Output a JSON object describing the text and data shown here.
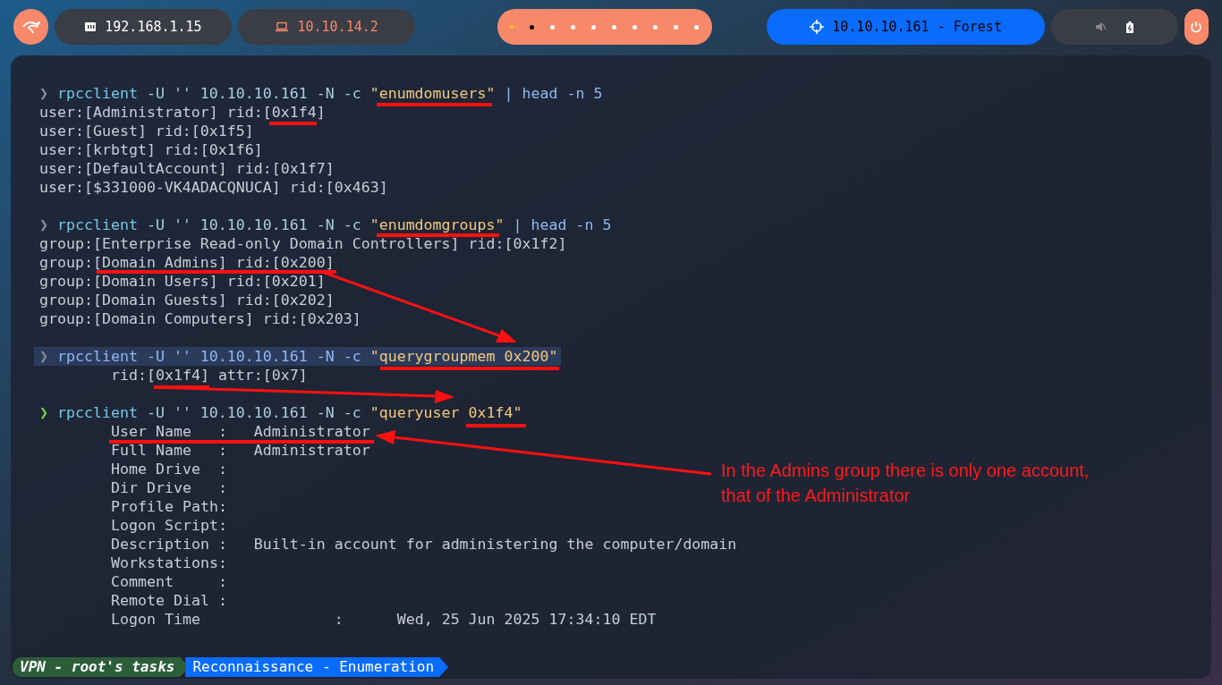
{
  "top_bar": {
    "ip_local": "192.168.1.15",
    "ip_vpn": "10.10.14.2",
    "workspaces": [
      {
        "kind": "occupied",
        "selected": false
      },
      {
        "kind": "plain",
        "selected": true
      },
      {
        "kind": "plain",
        "selected": false
      },
      {
        "kind": "plain",
        "selected": false
      },
      {
        "kind": "plain",
        "selected": false
      },
      {
        "kind": "plain",
        "selected": false
      },
      {
        "kind": "plain",
        "selected": false
      },
      {
        "kind": "plain",
        "selected": false
      },
      {
        "kind": "plain",
        "selected": false
      },
      {
        "kind": "plain",
        "selected": false
      }
    ],
    "target": "10.10.10.161 - Forest"
  },
  "terminal": {
    "blocks": [
      {
        "prompt": "❯",
        "prompt_active": false,
        "highlighted": false,
        "segments": [
          {
            "kind": "command",
            "text": "rpcclient"
          },
          {
            "kind": "argument",
            "text": " -U '' 10.10.10.161 -N -c "
          },
          {
            "kind": "string",
            "text": "\"enumdomusers\""
          },
          {
            "kind": "pipe",
            "text": " | head -n 5"
          }
        ],
        "output_indented": false,
        "output": [
          "user:[Administrator] rid:[0x1f4]",
          "user:[Guest] rid:[0x1f5]",
          "user:[krbtgt] rid:[0x1f6]",
          "user:[DefaultAccount] rid:[0x1f7]",
          "user:[$331000-VK4ADACQNUCA] rid:[0x463]"
        ]
      },
      {
        "prompt": "❯",
        "prompt_active": false,
        "highlighted": false,
        "segments": [
          {
            "kind": "command",
            "text": "rpcclient"
          },
          {
            "kind": "argument",
            "text": " -U '' 10.10.10.161 -N -c "
          },
          {
            "kind": "string",
            "text": "\"enumdomgroups\""
          },
          {
            "kind": "pipe",
            "text": " | head -n 5"
          }
        ],
        "output_indented": false,
        "output": [
          "group:[Enterprise Read-only Domain Controllers] rid:[0x1f2]",
          "group:[Domain Admins] rid:[0x200]",
          "group:[Domain Users] rid:[0x201]",
          "group:[Domain Guests] rid:[0x202]",
          "group:[Domain Computers] rid:[0x203]"
        ]
      },
      {
        "prompt": "❯",
        "prompt_active": false,
        "highlighted": true,
        "segments": [
          {
            "kind": "command",
            "text": "rpcclient"
          },
          {
            "kind": "argument",
            "text": " -U '' 10.10.10.161 -N -c "
          },
          {
            "kind": "string",
            "text": "\"querygroupmem 0x200\""
          }
        ],
        "output_indented": true,
        "output": [
          "rid:[0x1f4] attr:[0x7]"
        ]
      },
      {
        "prompt": "❯",
        "prompt_active": true,
        "highlighted": false,
        "segments": [
          {
            "kind": "command",
            "text": "rpcclient"
          },
          {
            "kind": "argument",
            "text": " -U '' 10.10.10.161 -N -c "
          },
          {
            "kind": "string",
            "text": "\"queryuser 0x1f4\""
          }
        ],
        "output_indented": true,
        "output": [
          "User Name   :   Administrator",
          "Full Name   :   Administrator",
          "Home Drive  :",
          "Dir Drive   :",
          "Profile Path:",
          "Logon Script:",
          "Description :   Built-in account for administering the computer/domain",
          "Workstations:",
          "Comment     :",
          "Remote Dial :",
          "Logon Time               :      Wed, 25 Jun 2025 17:34:10 EDT"
        ]
      }
    ]
  },
  "annotation": {
    "lines": [
      "In the Admins group there is only one account,",
      "that of the Administrator"
    ]
  },
  "status_tabs": [
    {
      "label": "VPN - root's tasks",
      "color": "#2d5e3a"
    },
    {
      "label": "Reconnaissance - Enumeration",
      "color": "#0a6cff"
    }
  ]
}
